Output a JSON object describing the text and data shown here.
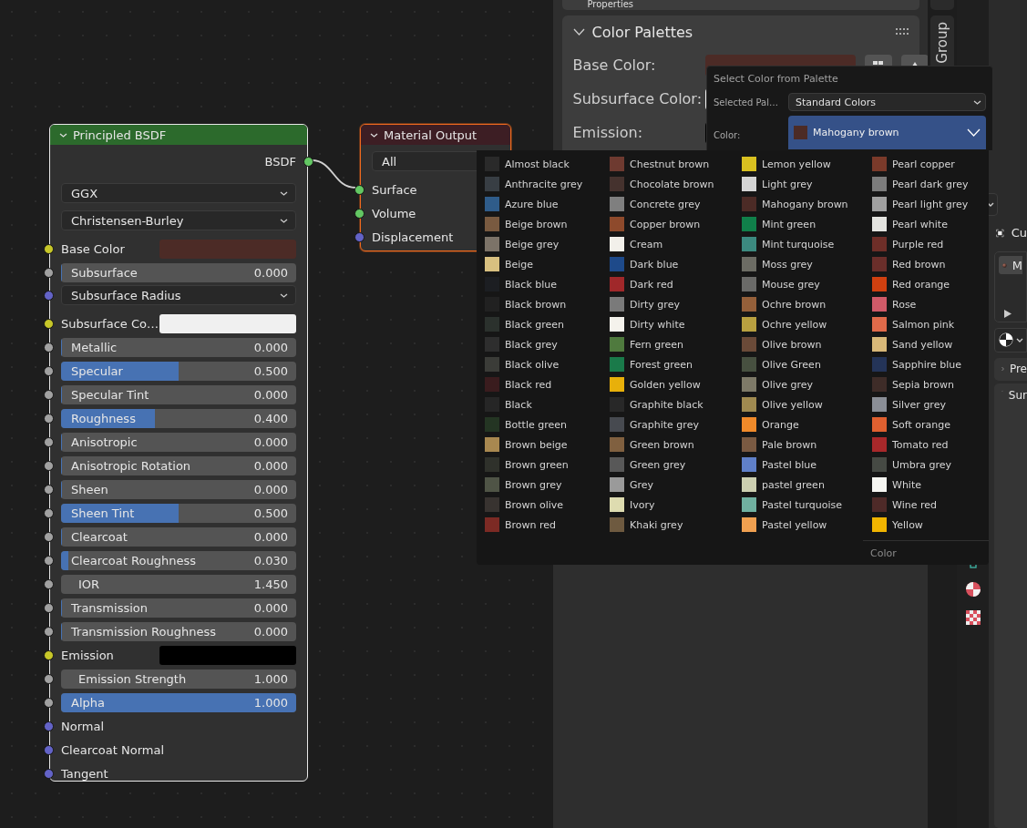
{
  "node_editor": {
    "nodes": [
      {
        "kind": "principled",
        "title": "Principled BSDF",
        "selected": true,
        "active": false,
        "rows": [
          {
            "kind": "output",
            "label": "BSDF",
            "socket": {
              "color": "#63c763"
            }
          },
          {
            "kind": "dropdown",
            "value": "GGX"
          },
          {
            "kind": "dropdown",
            "value": "Christensen-Burley"
          },
          {
            "kind": "color",
            "label": "Base Color",
            "socket": {
              "color": "#c7c729"
            },
            "color": "#4c2b26"
          },
          {
            "kind": "slider",
            "label": "Subsurface",
            "value": "0.000",
            "level": 0,
            "socket": {
              "color": "#a1a1a1"
            }
          },
          {
            "kind": "dropdown",
            "label": "Subsurface Radius",
            "socket": {
              "color": "#6363c7"
            }
          },
          {
            "kind": "color",
            "label": "Subsurface Co…",
            "socket": {
              "color": "#c7c729"
            },
            "color": "#f0f0f0"
          },
          {
            "kind": "slider",
            "label": "Metallic",
            "value": "0.000",
            "level": 0,
            "socket": {
              "color": "#a1a1a1"
            }
          },
          {
            "kind": "slider",
            "label": "Specular",
            "value": "0.500",
            "level": 0.5,
            "socket": {
              "color": "#a1a1a1"
            }
          },
          {
            "kind": "slider",
            "label": "Specular Tint",
            "value": "0.000",
            "level": 0,
            "socket": {
              "color": "#a1a1a1"
            }
          },
          {
            "kind": "slider",
            "label": "Roughness",
            "value": "0.400",
            "level": 0.4,
            "socket": {
              "color": "#a1a1a1"
            }
          },
          {
            "kind": "slider",
            "label": "Anisotropic",
            "value": "0.000",
            "level": 0,
            "socket": {
              "color": "#a1a1a1"
            }
          },
          {
            "kind": "slider",
            "label": "Anisotropic Rotation",
            "value": "0.000",
            "level": 0,
            "socket": {
              "color": "#a1a1a1"
            }
          },
          {
            "kind": "slider",
            "label": "Sheen",
            "value": "0.000",
            "level": 0,
            "socket": {
              "color": "#a1a1a1"
            }
          },
          {
            "kind": "slider",
            "label": "Sheen Tint",
            "value": "0.500",
            "level": 0.5,
            "socket": {
              "color": "#a1a1a1"
            }
          },
          {
            "kind": "slider",
            "label": "Clearcoat",
            "value": "0.000",
            "level": 0,
            "socket": {
              "color": "#a1a1a1"
            }
          },
          {
            "kind": "slider",
            "label": "Clearcoat Roughness",
            "value": "0.030",
            "level": 0.03,
            "socket": {
              "color": "#a1a1a1"
            }
          },
          {
            "kind": "number",
            "label": "IOR",
            "value": "1.450",
            "socket": {
              "color": "#a1a1a1"
            }
          },
          {
            "kind": "slider",
            "label": "Transmission",
            "value": "0.000",
            "level": 0,
            "socket": {
              "color": "#a1a1a1"
            }
          },
          {
            "kind": "slider",
            "label": "Transmission Roughness",
            "value": "0.000",
            "level": 0,
            "socket": {
              "color": "#a1a1a1"
            }
          },
          {
            "kind": "color",
            "label": "Emission",
            "socket": {
              "color": "#c7c729"
            },
            "color": "#000000"
          },
          {
            "kind": "number",
            "label": "Emission Strength",
            "value": "1.000",
            "socket": {
              "color": "#a1a1a1"
            }
          },
          {
            "kind": "slider",
            "label": "Alpha",
            "value": "1.000",
            "level": 1,
            "socket": {
              "color": "#a1a1a1"
            }
          },
          {
            "kind": "input",
            "label": "Normal",
            "socket": {
              "color": "#6363c7"
            }
          },
          {
            "kind": "input",
            "label": "Clearcoat Normal",
            "socket": {
              "color": "#6363c7"
            }
          },
          {
            "kind": "input",
            "label": "Tangent",
            "socket": {
              "color": "#6363c7"
            }
          }
        ]
      },
      {
        "kind": "output",
        "title": "Material Output",
        "selected": true,
        "active": true,
        "rows": [
          {
            "kind": "dropdown",
            "value": "All"
          },
          {
            "kind": "input",
            "label": "Surface",
            "socket": {
              "color": "#63c763"
            }
          },
          {
            "kind": "input",
            "label": "Volume",
            "socket": {
              "color": "#63c763"
            }
          },
          {
            "kind": "input",
            "label": "Displacement",
            "socket": {
              "color": "#6363c7"
            }
          }
        ]
      }
    ]
  },
  "sidebar": {
    "header": "Properties",
    "panel": {
      "title": "Color Palettes",
      "fields": [
        {
          "label": "Base Color:",
          "color": "#4c2b26",
          "tools": true
        },
        {
          "label": "Subsurface Color:",
          "color": "#f0f0f0"
        },
        {
          "label": "Emission:",
          "color": "#000000"
        }
      ]
    }
  },
  "side_tab": {
    "label": "Group"
  },
  "properties_editor": {
    "object_name": "Cu",
    "material_slot": "M",
    "panels": [
      {
        "title": "Pre",
        "expanded": false
      },
      {
        "title": "Sur",
        "expanded": true
      }
    ]
  },
  "palette_popup": {
    "title": "Select Color from Palette",
    "palette_label": "Selected Pal…",
    "palette": "Standard Colors",
    "color_label": "Color:",
    "color": {
      "name": "Mahogany brown",
      "color": "#4c2b26"
    }
  },
  "color_menu": {
    "columns": [
      [
        {
          "name": "Almost black",
          "color": "#2a2a2a",
          "selected": false
        },
        {
          "name": "Anthracite grey",
          "color": "#383e44",
          "selected": false
        },
        {
          "name": "Azure blue",
          "color": "#2f5c8a",
          "selected": false
        },
        {
          "name": "Beige brown",
          "color": "#795a40",
          "selected": false
        },
        {
          "name": "Beige grey",
          "color": "#7c7368",
          "selected": false
        },
        {
          "name": "Beige",
          "color": "#d8c080",
          "selected": false
        },
        {
          "name": "Black blue",
          "color": "#1c1e22",
          "selected": false
        },
        {
          "name": "Black brown",
          "color": "#212121",
          "selected": false
        },
        {
          "name": "Black green",
          "color": "#2b312d",
          "selected": false
        },
        {
          "name": "Black grey",
          "color": "#2e2e2e",
          "selected": false
        },
        {
          "name": "Black olive",
          "color": "#3b3c38",
          "selected": false
        },
        {
          "name": "Black red",
          "color": "#3a1c1e",
          "selected": false
        },
        {
          "name": "Black",
          "color": "#262626",
          "selected": false
        },
        {
          "name": "Bottle green",
          "color": "#243523",
          "selected": false
        },
        {
          "name": "Brown beige",
          "color": "#a88850",
          "selected": false
        },
        {
          "name": "Brown green",
          "color": "#2f312b",
          "selected": false
        },
        {
          "name": "Brown grey",
          "color": "#4f5446",
          "selected": false
        },
        {
          "name": "Brown olive",
          "color": "#383330",
          "selected": false
        },
        {
          "name": "Brown red",
          "color": "#7c2a24",
          "selected": false
        }
      ],
      [
        {
          "name": "Chestnut brown",
          "color": "#6e3a30",
          "selected": false
        },
        {
          "name": "Chocolate brown",
          "color": "#45322e",
          "selected": false
        },
        {
          "name": "Concrete grey",
          "color": "#7f7f7f",
          "selected": false
        },
        {
          "name": "Copper brown",
          "color": "#8e4a2c",
          "selected": false
        },
        {
          "name": "Cream",
          "color": "#f2f0ea",
          "selected": false
        },
        {
          "name": "Dark blue",
          "color": "#1e4a8a",
          "selected": false
        },
        {
          "name": "Dark red",
          "color": "#a0282a",
          "selected": false
        },
        {
          "name": "Dirty grey",
          "color": "#7a7a7a",
          "selected": false
        },
        {
          "name": "Dirty white",
          "color": "#f4f2ec",
          "selected": false
        },
        {
          "name": "Fern green",
          "color": "#4f7a3e",
          "selected": false
        },
        {
          "name": "Forest green",
          "color": "#1a7a4a",
          "selected": false
        },
        {
          "name": "Golden yellow",
          "color": "#e8b00a",
          "selected": false
        },
        {
          "name": "Graphite black",
          "color": "#282828",
          "selected": false
        },
        {
          "name": "Graphite grey",
          "color": "#474a50",
          "selected": false
        },
        {
          "name": "Green brown",
          "color": "#806040",
          "selected": false
        },
        {
          "name": "Green grey",
          "color": "#585858",
          "selected": false
        },
        {
          "name": "Grey",
          "color": "#9a9a9a",
          "selected": false
        },
        {
          "name": "Ivory",
          "color": "#dedcb0",
          "selected": false
        },
        {
          "name": "Khaki grey",
          "color": "#6e5a40",
          "selected": false
        }
      ],
      [
        {
          "name": "Lemon yellow",
          "color": "#d8c020",
          "selected": false
        },
        {
          "name": "Light grey",
          "color": "#d4d4d4",
          "selected": false
        },
        {
          "name": "Mahogany brown",
          "color": "#4c2b26",
          "selected": false
        },
        {
          "name": "Mint green",
          "color": "#10804a",
          "selected": false
        },
        {
          "name": "Mint turquoise",
          "color": "#3c8a80",
          "selected": false
        },
        {
          "name": "Moss grey",
          "color": "#6c6c64",
          "selected": false
        },
        {
          "name": "Mouse grey",
          "color": "#6a6a68",
          "selected": false
        },
        {
          "name": "Ochre brown",
          "color": "#95603a",
          "selected": false
        },
        {
          "name": "Ochre yellow",
          "color": "#b8a040",
          "selected": false
        },
        {
          "name": "Olive brown",
          "color": "#6a4a38",
          "selected": false
        },
        {
          "name": "Olive Green",
          "color": "#475040",
          "selected": false
        },
        {
          "name": "Olive grey",
          "color": "#7e7a68",
          "selected": false
        },
        {
          "name": "Olive yellow",
          "color": "#a08a50",
          "selected": false
        },
        {
          "name": "Orange",
          "color": "#f08a2a",
          "selected": false
        },
        {
          "name": "Pale brown",
          "color": "#7a5a42",
          "selected": false
        },
        {
          "name": "Pastel blue",
          "color": "#6080c8",
          "selected": false
        },
        {
          "name": "pastel green",
          "color": "#cccfb0",
          "selected": false
        },
        {
          "name": "Pastel turquoise",
          "color": "#70b0a0",
          "selected": false
        },
        {
          "name": "Pastel yellow",
          "color": "#f0a050",
          "selected": false
        }
      ],
      [
        {
          "name": "Pearl copper",
          "color": "#7a3a2a",
          "selected": false
        },
        {
          "name": "Pearl dark grey",
          "color": "#7c7c7c",
          "selected": false
        },
        {
          "name": "Pearl light grey",
          "color": "#a0a0a0",
          "selected": false
        },
        {
          "name": "Pearl white",
          "color": "#e4e4e0",
          "selected": false
        },
        {
          "name": "Purple red",
          "color": "#6e2e28",
          "selected": false
        },
        {
          "name": "Red brown",
          "color": "#6a2e2a",
          "selected": false
        },
        {
          "name": "Red orange",
          "color": "#d04010",
          "selected": false
        },
        {
          "name": "Rose",
          "color": "#d05a68",
          "selected": false
        },
        {
          "name": "Salmon pink",
          "color": "#e06a4a",
          "selected": false
        },
        {
          "name": "Sand yellow",
          "color": "#d8b878",
          "selected": false
        },
        {
          "name": "Sapphire blue",
          "color": "#243458",
          "selected": false
        },
        {
          "name": "Sepia brown",
          "color": "#3e2c28",
          "selected": false
        },
        {
          "name": "Silver grey",
          "color": "#8a8e96",
          "selected": false
        },
        {
          "name": "Soft orange",
          "color": "#e06030",
          "selected": false
        },
        {
          "name": "Tomato red",
          "color": "#a8282a",
          "selected": false
        },
        {
          "name": "Umbra grey",
          "color": "#464a44",
          "selected": false
        },
        {
          "name": "White",
          "color": "#f6f6f2",
          "selected": false
        },
        {
          "name": "Wine red",
          "color": "#4e2a28",
          "selected": false
        },
        {
          "name": "Yellow",
          "color": "#f0b400",
          "selected": false
        }
      ]
    ],
    "footer": "Color"
  }
}
